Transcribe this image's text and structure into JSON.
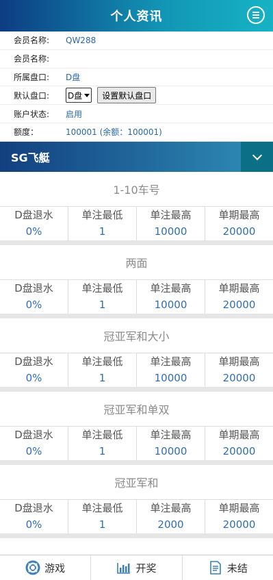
{
  "header": {
    "title": "个人资讯",
    "menu_icon": "menu-icon"
  },
  "info": [
    {
      "label": "会员名称:",
      "value": "QW288"
    },
    {
      "label": "会员名称:",
      "value": ""
    },
    {
      "label": "所属盘口:",
      "value": "D盘"
    },
    {
      "label": "默认盘口:",
      "select_value": "D盘",
      "button": "设置默认盘口"
    },
    {
      "label": "账户状态:",
      "value": "启用"
    },
    {
      "label": "额度：",
      "value": "100001 (余额：100001)"
    }
  ],
  "game": {
    "name": "SG飞艇"
  },
  "col_headers": [
    "D盘退水",
    "单注最低",
    "单注最高",
    "单期最高"
  ],
  "sections": [
    {
      "title": "1-10车号",
      "values": [
        "0%",
        "1",
        "10000",
        "20000"
      ]
    },
    {
      "title": "两面",
      "values": [
        "0%",
        "1",
        "10000",
        "20000"
      ]
    },
    {
      "title": "冠亚军和大小",
      "values": [
        "0%",
        "1",
        "10000",
        "20000"
      ]
    },
    {
      "title": "冠亚军和单双",
      "values": [
        "0%",
        "1",
        "10000",
        "20000"
      ]
    },
    {
      "title": "冠亚军和",
      "values": [
        "0%",
        "1",
        "2000",
        "20000"
      ]
    }
  ],
  "tabs": [
    {
      "label": "游戏",
      "icon": "lifebuoy-icon"
    },
    {
      "label": "开奖",
      "icon": "bar-chart-icon"
    },
    {
      "label": "未结",
      "icon": "document-icon"
    }
  ],
  "colors": {
    "accent": "#2f6fb1",
    "header_start": "#0d3c83",
    "header_end": "#16b3c5"
  }
}
